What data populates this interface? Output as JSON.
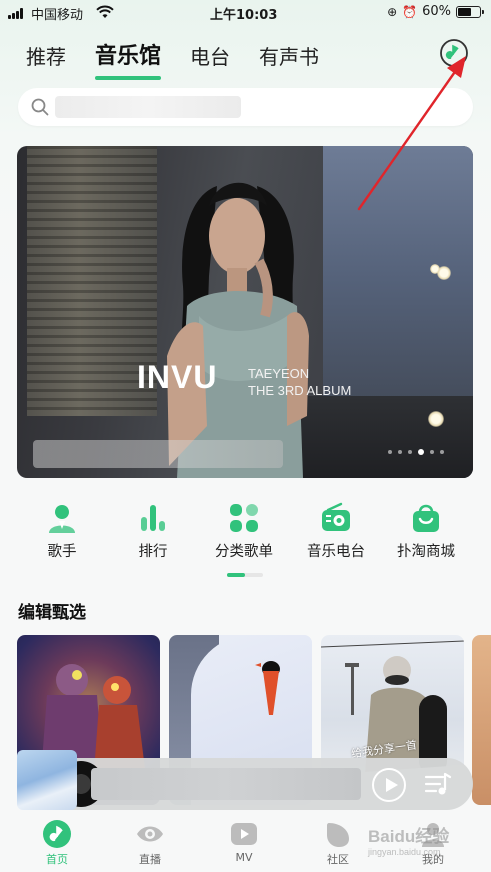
{
  "status_bar": {
    "carrier": "中国移动",
    "time": "上午10:03",
    "battery": "60%",
    "battery_level": 0.6
  },
  "tabs": [
    {
      "label": "推荐",
      "active": false
    },
    {
      "label": "音乐馆",
      "active": true
    },
    {
      "label": "电台",
      "active": false
    },
    {
      "label": "有声书",
      "active": false
    }
  ],
  "header_icon": "music-note-icon",
  "banner": {
    "title": "INVU",
    "subtitle_line1": "TAEYEON",
    "subtitle_line2": "THE 3RD ALBUM",
    "slide_count": 6,
    "active_slide": 4
  },
  "categories": [
    {
      "label": "歌手",
      "icon": "singer-icon"
    },
    {
      "label": "排行",
      "icon": "chart-icon"
    },
    {
      "label": "分类歌单",
      "icon": "category-icon"
    },
    {
      "label": "音乐电台",
      "icon": "radio-icon"
    },
    {
      "label": "扑淘商城",
      "icon": "shop-icon"
    }
  ],
  "section_title": "编辑甄选",
  "cards": [
    {
      "caption": ""
    },
    {
      "caption": ""
    },
    {
      "caption": "给我分享一首"
    }
  ],
  "bottom_nav": [
    {
      "label": "首页",
      "icon": "home-icon",
      "active": true
    },
    {
      "label": "直播",
      "icon": "live-icon",
      "active": false
    },
    {
      "label": "MV",
      "icon": "mv-icon",
      "active": false
    },
    {
      "label": "社区",
      "icon": "community-icon",
      "active": false
    },
    {
      "label": "我的",
      "icon": "profile-icon",
      "active": false
    }
  ],
  "watermark": "Baidu经验",
  "watermark_sub": "jingyan.baidu.com",
  "colors": {
    "accent": "#31c27c",
    "annotation_arrow": "#e0252b"
  }
}
